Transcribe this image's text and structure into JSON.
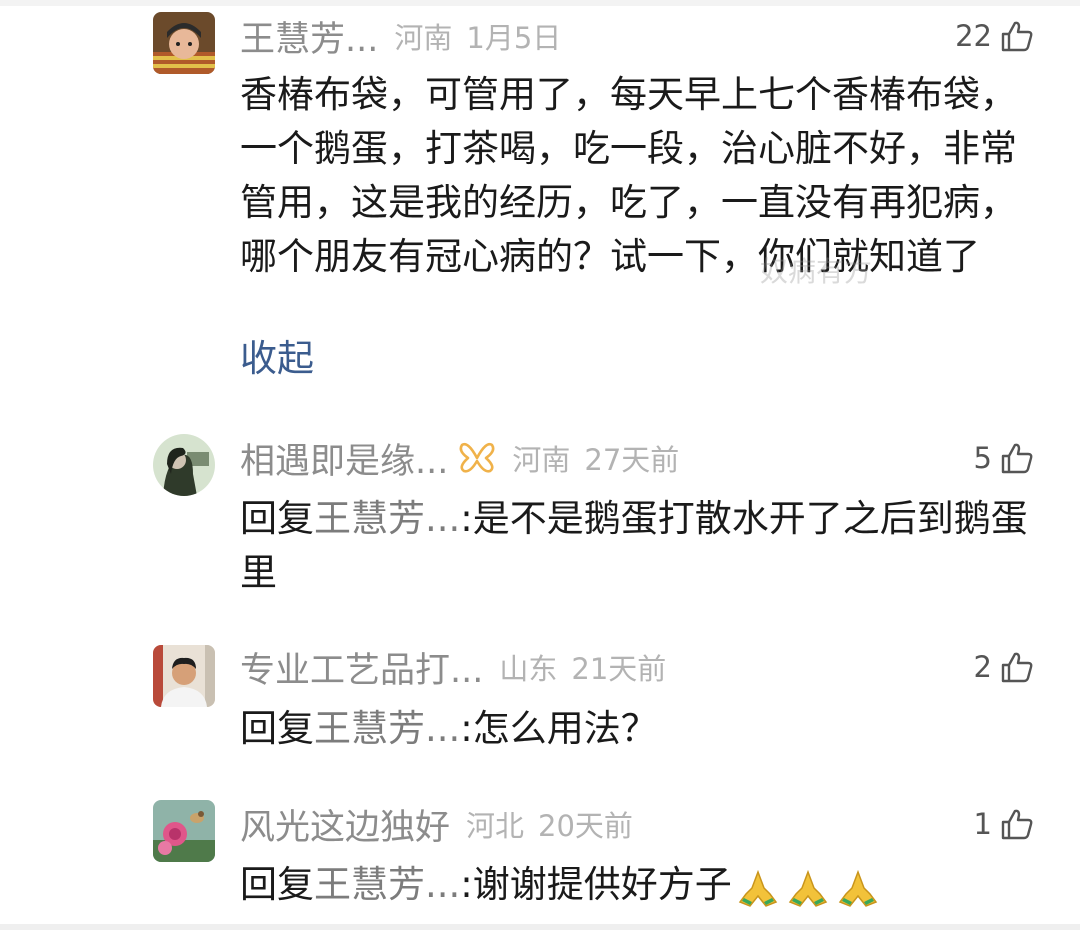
{
  "comments": [
    {
      "name": "王慧芳...",
      "location": "河南",
      "time": "1月5日",
      "likes": "22",
      "text": "香椿布袋，可管用了，每天早上七个香椿布袋，一个鹅蛋，打茶喝，吃一段，治心脏不好，非常管用，这是我的经历，吃了，一直没有再犯病，哪个朋友有冠心病的？试一下，你们就知道了",
      "collapse": "收起",
      "watermark": "奴病有方"
    },
    {
      "name": "相遇即是缘...",
      "location": "河南",
      "time": "27天前",
      "likes": "5",
      "reply_prefix": "回复",
      "reply_target": "王慧芳...",
      "text": ":是不是鹅蛋打散水开了之后到鹅蛋里"
    },
    {
      "name": "专业工艺品打...",
      "location": "山东",
      "time": "21天前",
      "likes": "2",
      "reply_prefix": "回复",
      "reply_target": "王慧芳...",
      "text": ":怎么用法？"
    },
    {
      "name": "风光这边独好",
      "location": "河北",
      "time": "20天前",
      "likes": "1",
      "reply_prefix": "回复",
      "reply_target": "王慧芳...",
      "text": ":谢谢提供好方子",
      "emojis": [
        "folded-hands",
        "folded-hands",
        "folded-hands"
      ]
    }
  ],
  "colors": {
    "name": "#8c8c8c",
    "meta": "#b3b3b3",
    "text": "#1a1a1a",
    "link": "#3b5c8e",
    "vip": "#f0b24a"
  }
}
